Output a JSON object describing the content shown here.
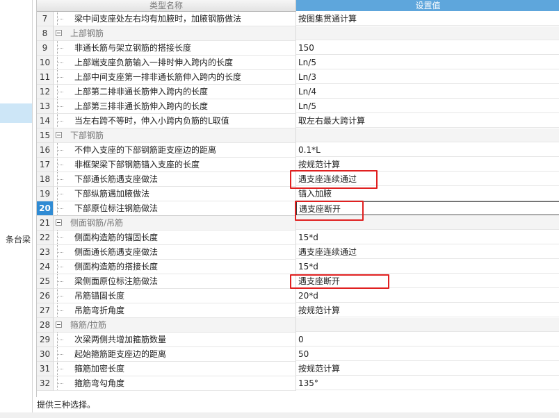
{
  "header": {
    "col_name": "类型名称",
    "col_value": "设置值"
  },
  "left_panel": {
    "partial_label": "条台梁"
  },
  "rows": [
    {
      "num": "7",
      "name": "梁中间支座处左右均有加腋时，加腋钢筋做法",
      "value": "按图集贯通计算",
      "group": false
    },
    {
      "num": "8",
      "name": "上部钢筋",
      "value": "",
      "group": true
    },
    {
      "num": "9",
      "name": "非通长筋与架立钢筋的搭接长度",
      "value": "150",
      "group": false
    },
    {
      "num": "10",
      "name": "上部端支座负筋输入一排时伸入跨内的长度",
      "value": "Ln/5",
      "group": false
    },
    {
      "num": "11",
      "name": "上部中间支座第一排非通长筋伸入跨内的长度",
      "value": "Ln/3",
      "group": false
    },
    {
      "num": "12",
      "name": "上部第二排非通长筋伸入跨内的长度",
      "value": "Ln/4",
      "group": false
    },
    {
      "num": "13",
      "name": "上部第三排非通长筋伸入跨内的长度",
      "value": "Ln/5",
      "group": false
    },
    {
      "num": "14",
      "name": "当左右跨不等时，伸入小跨内负筋的L取值",
      "value": "取左右最大跨计算",
      "group": false
    },
    {
      "num": "15",
      "name": "下部钢筋",
      "value": "",
      "group": true
    },
    {
      "num": "16",
      "name": "不伸入支座的下部钢筋距支座边的距离",
      "value": "0.1*L",
      "group": false
    },
    {
      "num": "17",
      "name": "非框架梁下部钢筋锚入支座的长度",
      "value": "按规范计算",
      "group": false
    },
    {
      "num": "18",
      "name": "下部通长筋遇支座做法",
      "value": "遇支座连续通过",
      "group": false
    },
    {
      "num": "19",
      "name": "下部纵筋遇加腋做法",
      "value": "锚入加腋",
      "group": false
    },
    {
      "num": "20",
      "name": "下部原位标注钢筋做法",
      "value": "遇支座断开",
      "group": false,
      "selected": true
    },
    {
      "num": "21",
      "name": "侧面钢筋/吊筋",
      "value": "",
      "group": true
    },
    {
      "num": "22",
      "name": "侧面构造筋的锚固长度",
      "value": "15*d",
      "group": false
    },
    {
      "num": "23",
      "name": "侧面通长筋遇支座做法",
      "value": "遇支座连续通过",
      "group": false
    },
    {
      "num": "24",
      "name": "侧面构造筋的搭接长度",
      "value": "15*d",
      "group": false
    },
    {
      "num": "25",
      "name": "梁侧面原位标注筋做法",
      "value": "遇支座断开",
      "group": false
    },
    {
      "num": "26",
      "name": "吊筋锚固长度",
      "value": "20*d",
      "group": false
    },
    {
      "num": "27",
      "name": "吊筋弯折角度",
      "value": "按规范计算",
      "group": false
    },
    {
      "num": "28",
      "name": "箍筋/拉筋",
      "value": "",
      "group": true
    },
    {
      "num": "29",
      "name": "次梁两侧共增加箍筋数量",
      "value": "0",
      "group": false
    },
    {
      "num": "30",
      "name": "起始箍筋距支座边的距离",
      "value": "50",
      "group": false
    },
    {
      "num": "31",
      "name": "箍筋加密长度",
      "value": "按规范计算",
      "group": false
    },
    {
      "num": "32",
      "name": "箍筋弯勾角度",
      "value": "135°",
      "group": false
    }
  ],
  "status_text": "提供三种选择。",
  "colors": {
    "header_active": "#5ea6dc",
    "selected_row_number": "#2f8bd4",
    "highlight_box": "#e02020"
  }
}
